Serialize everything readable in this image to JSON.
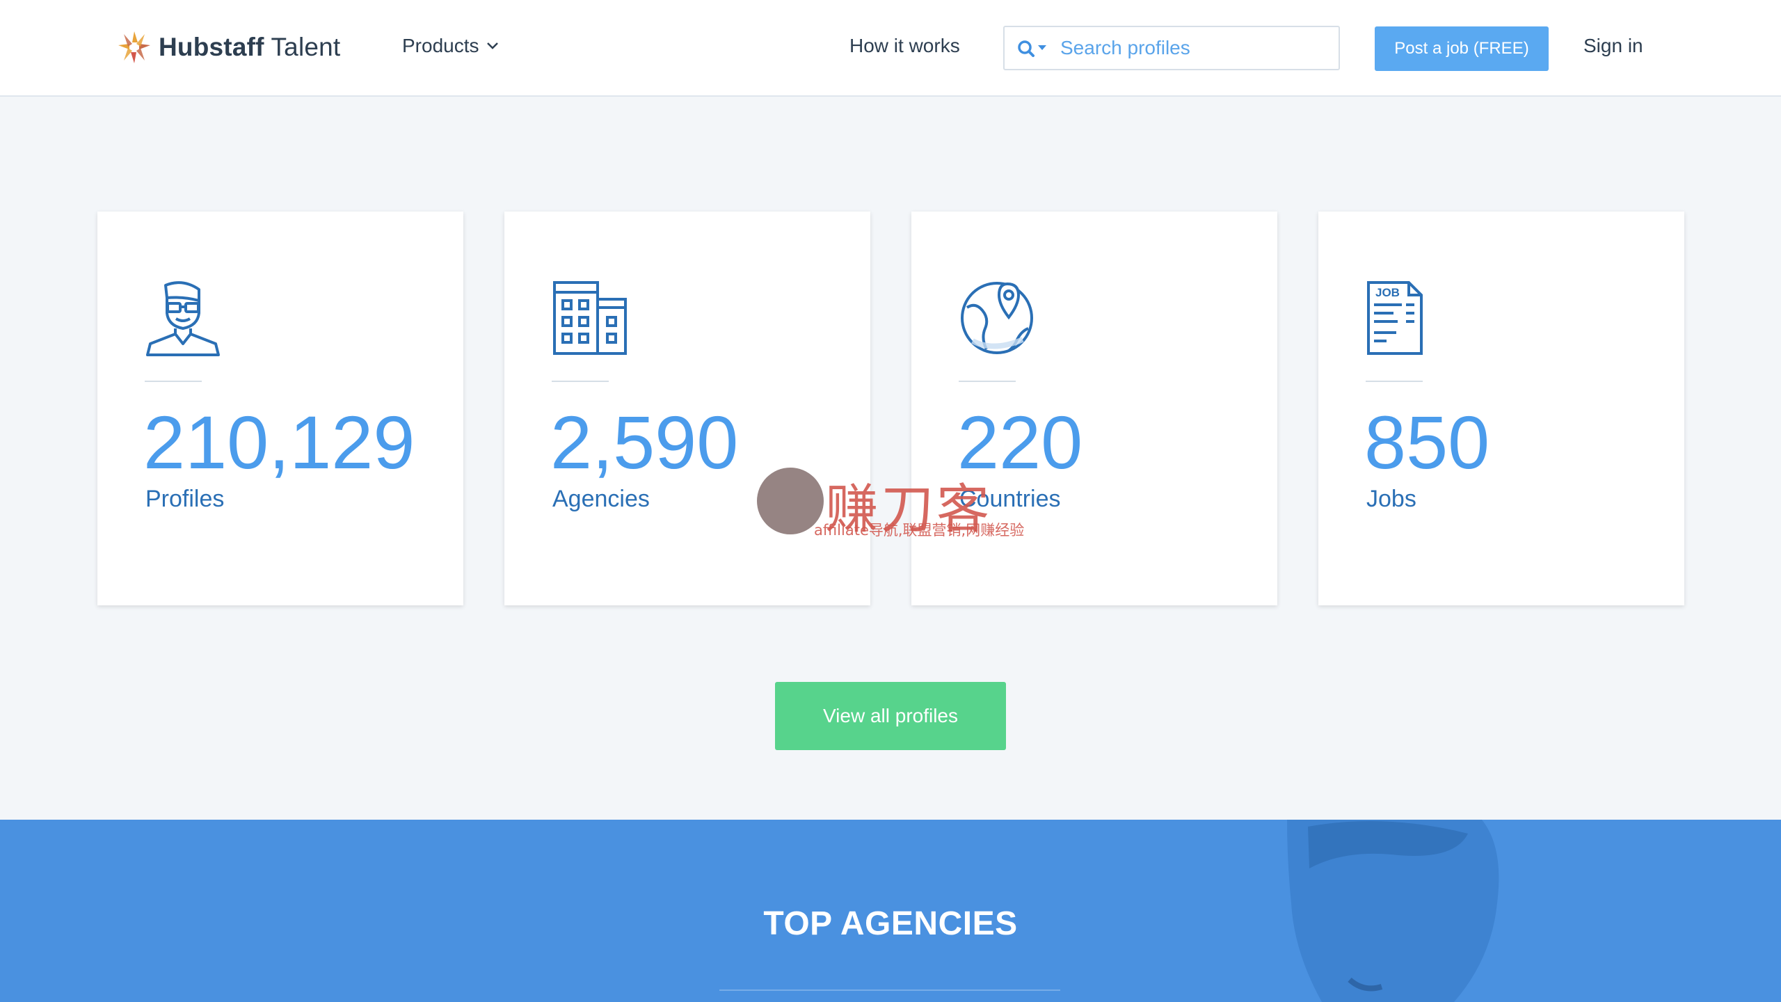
{
  "header": {
    "logo": {
      "brand": "Hubstaff",
      "product": "Talent"
    },
    "nav": {
      "products_label": "Products",
      "how_label": "How it works"
    },
    "search": {
      "placeholder": "Search profiles"
    },
    "post_job_label": "Post a job (FREE)",
    "signin_label": "Sign in"
  },
  "stats": [
    {
      "icon": "person-icon",
      "value": "210,129",
      "label": "Profiles"
    },
    {
      "icon": "building-icon",
      "value": "2,590",
      "label": "Agencies"
    },
    {
      "icon": "globe-pin-icon",
      "value": "220",
      "label": "Countries"
    },
    {
      "icon": "job-document-icon",
      "value": "850",
      "label": "Jobs"
    }
  ],
  "job_icon_text": "JOB",
  "watermark": {
    "title": "赚刀客",
    "subtitle": "affiliate导航,联盟营销,网赚经验"
  },
  "view_all_label": "View all profiles",
  "agencies_section": {
    "title": "TOP AGENCIES"
  },
  "colors": {
    "accent": "#4b9cec",
    "button_blue": "#5aa9f1",
    "button_green": "#57d38c",
    "section_blue": "#4a91e0"
  }
}
